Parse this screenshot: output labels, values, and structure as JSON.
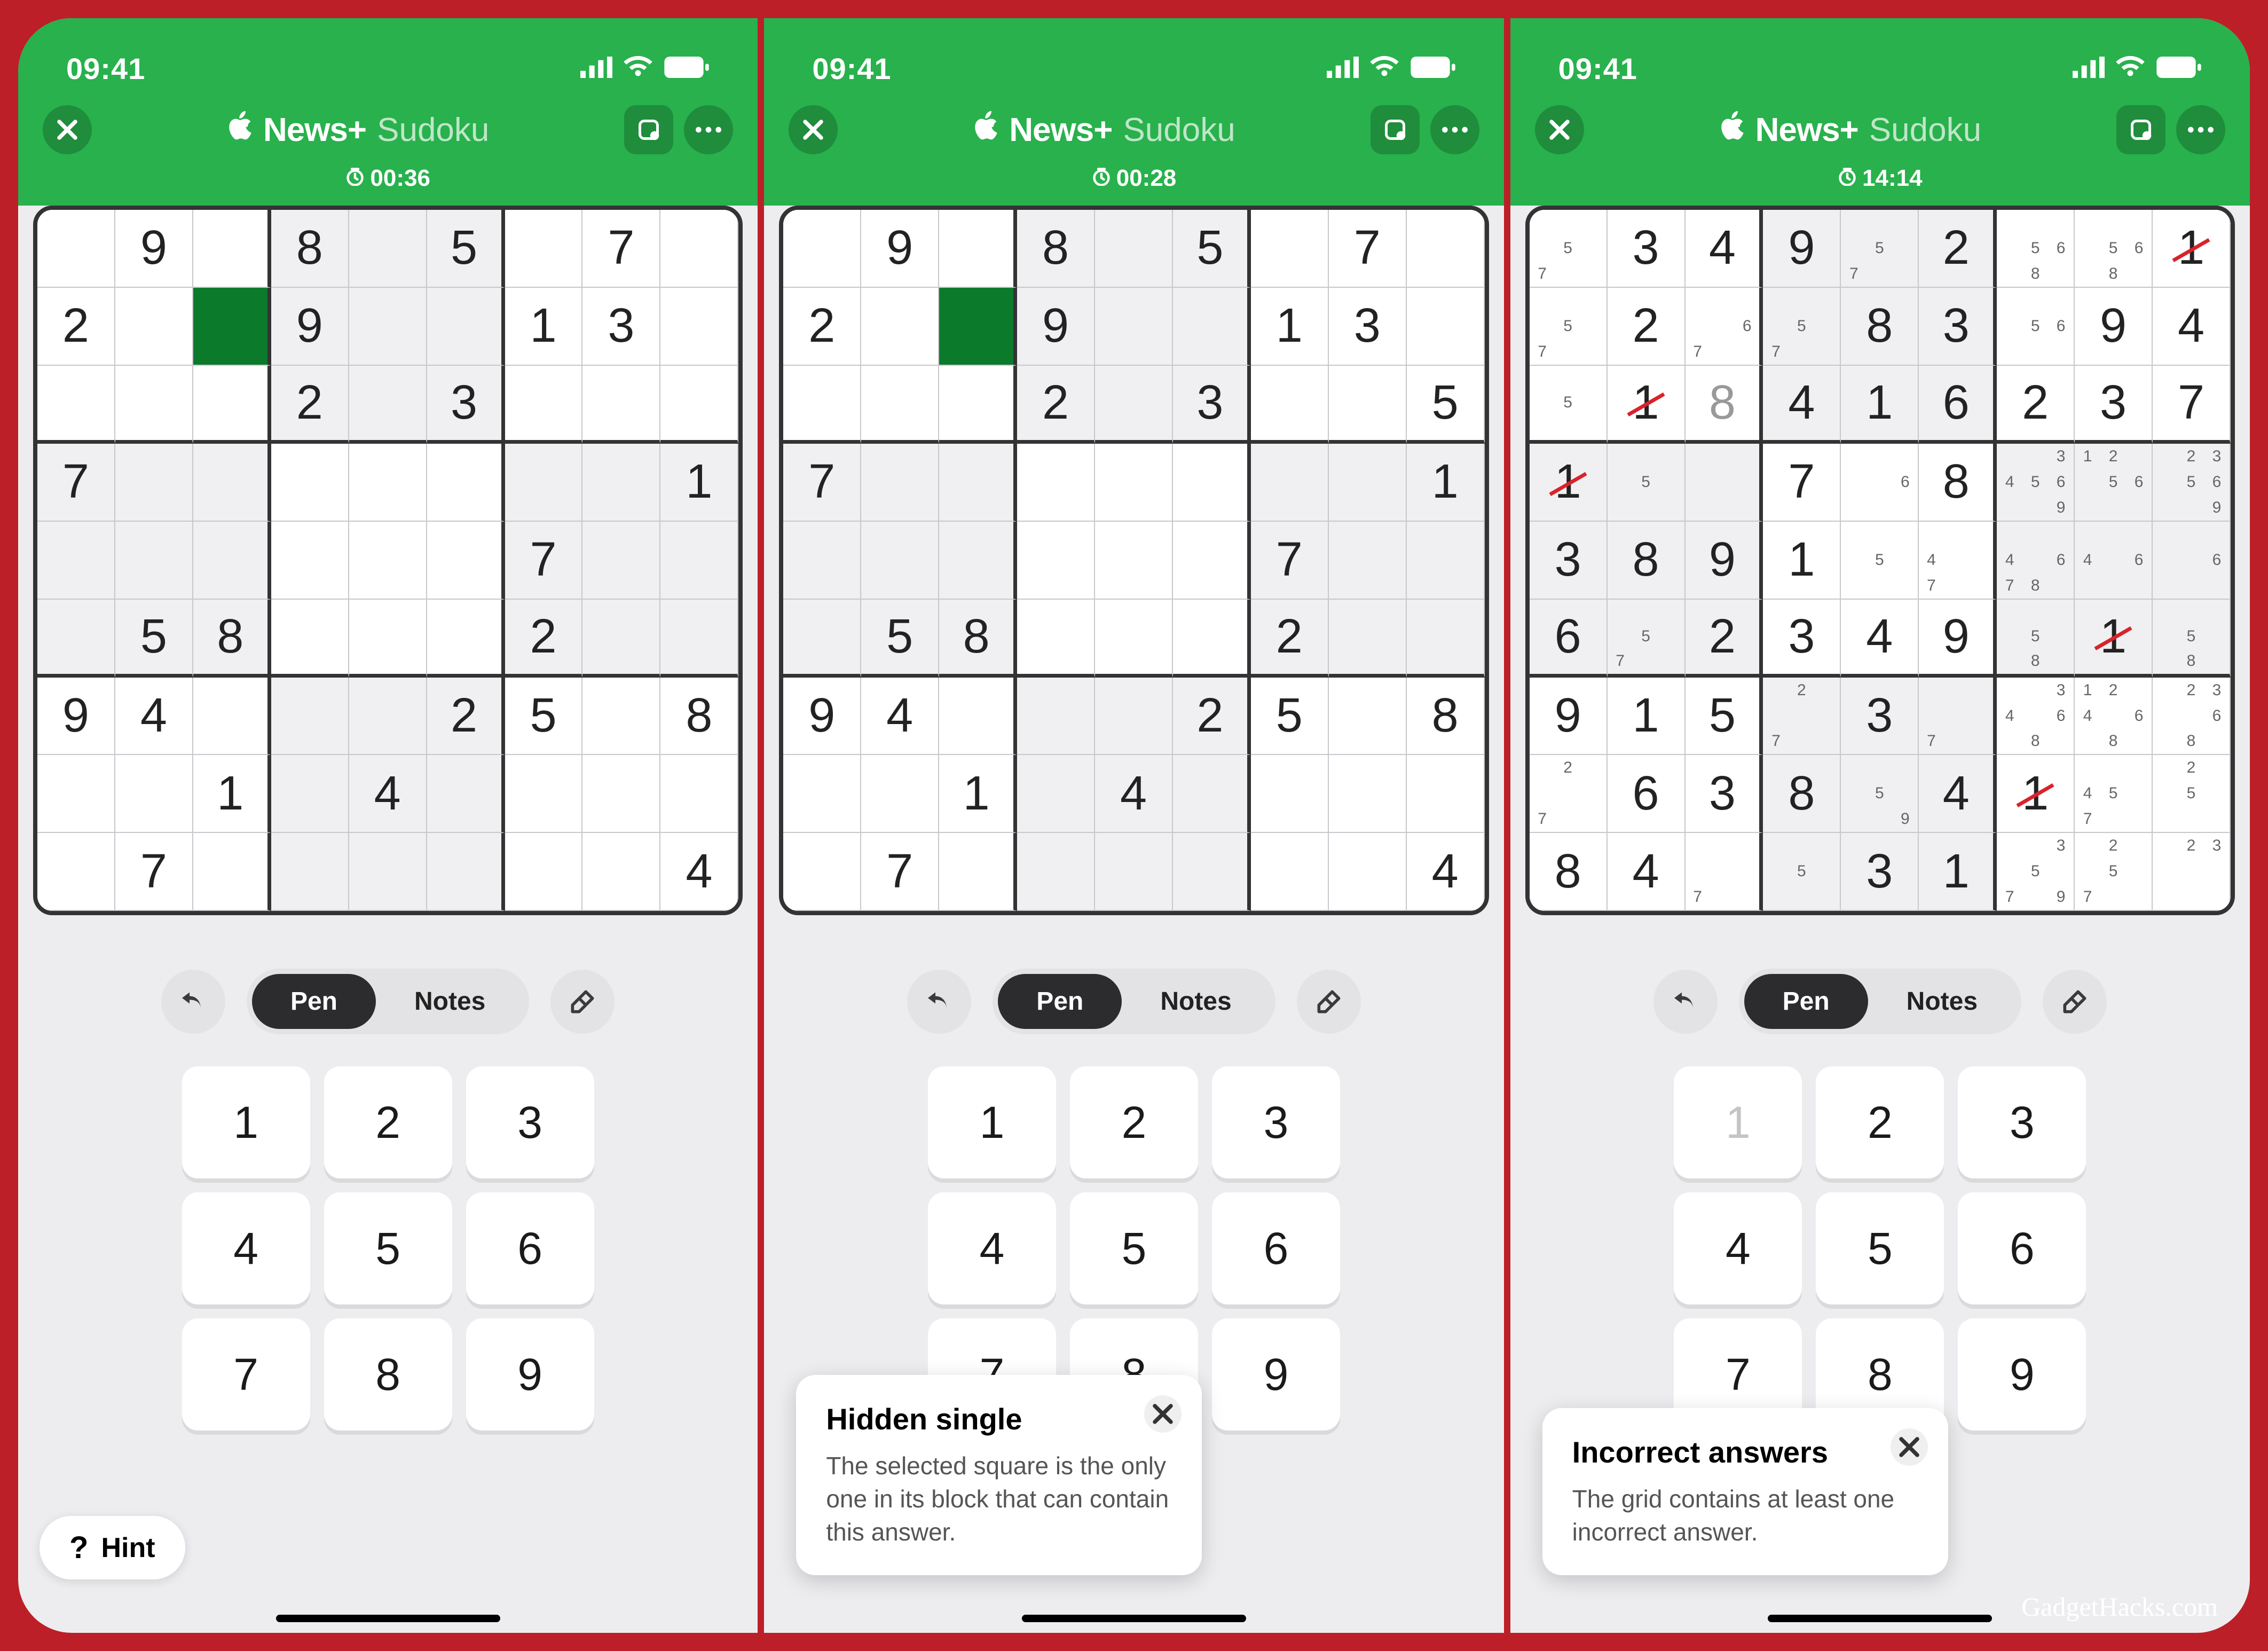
{
  "watermark": "GadgetHacks.com",
  "screens": [
    {
      "status": {
        "time": "09:41"
      },
      "header": {
        "brand": "News+",
        "title": "Sudoku",
        "timer": "00:36"
      },
      "hint_button": {
        "icon": "?",
        "label": "Hint"
      },
      "mode": {
        "pen": "Pen",
        "notes": "Notes"
      },
      "keypad": [
        "1",
        "2",
        "3",
        "4",
        "5",
        "6",
        "7",
        "8",
        "9"
      ],
      "board": [
        [
          "",
          "9",
          "",
          "8",
          "",
          "5",
          "",
          "7",
          ""
        ],
        [
          "2",
          "",
          "",
          "9",
          "",
          "",
          "1",
          "3",
          ""
        ],
        [
          "",
          "",
          "",
          "2",
          "",
          "3",
          "",
          "",
          ""
        ],
        [
          "7",
          "",
          "",
          "",
          "",
          "",
          "",
          "",
          "1"
        ],
        [
          "",
          "",
          "",
          "",
          "",
          "",
          "7",
          "",
          ""
        ],
        [
          "",
          "5",
          "8",
          "",
          "",
          "",
          "2",
          "",
          ""
        ],
        [
          "9",
          "4",
          "",
          "",
          "",
          "2",
          "5",
          "",
          "8"
        ],
        [
          "",
          "",
          "1",
          "",
          "4",
          "",
          "",
          "",
          ""
        ],
        [
          "",
          "7",
          "",
          "",
          "",
          "",
          "",
          "",
          "4"
        ]
      ],
      "selected": [
        1,
        2
      ]
    },
    {
      "status": {
        "time": "09:41"
      },
      "header": {
        "brand": "News+",
        "title": "Sudoku",
        "timer": "00:28"
      },
      "mode": {
        "pen": "Pen",
        "notes": "Notes"
      },
      "tip": {
        "title": "Hidden single",
        "body": "The selected square is the only one in its block that can contain this answer."
      },
      "keypad": [
        "1",
        "2",
        "3",
        "4",
        "5",
        "6",
        "7",
        "8",
        "9"
      ],
      "board": [
        [
          "",
          "9",
          "",
          "8",
          "",
          "5",
          "",
          "7",
          ""
        ],
        [
          "2",
          "",
          "",
          "9",
          "",
          "",
          "1",
          "3",
          ""
        ],
        [
          "",
          "",
          "",
          "2",
          "",
          "3",
          "",
          "",
          "5"
        ],
        [
          "7",
          "",
          "",
          "",
          "",
          "",
          "",
          "",
          "1"
        ],
        [
          "",
          "",
          "",
          "",
          "",
          "",
          "7",
          "",
          ""
        ],
        [
          "",
          "5",
          "8",
          "",
          "",
          "",
          "2",
          "",
          ""
        ],
        [
          "9",
          "4",
          "",
          "",
          "",
          "2",
          "5",
          "",
          "8"
        ],
        [
          "",
          "",
          "1",
          "",
          "4",
          "",
          "",
          "",
          ""
        ],
        [
          "",
          "7",
          "",
          "",
          "",
          "",
          "",
          "",
          "4"
        ]
      ],
      "selected": [
        1,
        2
      ]
    },
    {
      "status": {
        "time": "09:41"
      },
      "header": {
        "brand": "News+",
        "title": "Sudoku",
        "timer": "14:14"
      },
      "mode": {
        "pen": "Pen",
        "notes": "Notes"
      },
      "tip": {
        "title": "Incorrect answers",
        "body": "The grid contains at least one incorrect answer."
      },
      "keypad": [
        "1",
        "2",
        "3",
        "4",
        "5",
        "6",
        "7",
        "8",
        "9"
      ],
      "keypad_dim": [
        0
      ],
      "board": [
        [
          {
            "n": [
              "",
              "",
              "",
              "",
              "5",
              "",
              "7",
              "",
              ""
            ]
          },
          "3",
          "4",
          "9",
          {
            "n": [
              "",
              "",
              "",
              "",
              "5",
              "",
              "7",
              "",
              ""
            ]
          },
          "2",
          {
            "n": [
              "",
              "",
              "",
              "",
              "5",
              "6",
              "",
              "8",
              ""
            ]
          },
          {
            "n": [
              "",
              "",
              "",
              "",
              "5",
              "6",
              "",
              "8",
              ""
            ]
          },
          {
            "v": "1",
            "strike": true
          }
        ],
        [
          {
            "n": [
              "",
              "",
              "",
              "",
              "5",
              "",
              "7",
              "",
              ""
            ]
          },
          "2",
          {
            "n": [
              "",
              "",
              "",
              "",
              "",
              "6",
              "7",
              "",
              ""
            ]
          },
          {
            "n": [
              "",
              "",
              "",
              "",
              "5",
              "",
              "7",
              "",
              ""
            ]
          },
          "8",
          "3",
          {
            "n": [
              "",
              "",
              "",
              "",
              "5",
              "6",
              "",
              "",
              ""
            ]
          },
          "9",
          "4"
        ],
        [
          {
            "n": [
              "",
              "",
              "",
              "",
              "5",
              "",
              "",
              "",
              ""
            ]
          },
          {
            "v": "1",
            "strike": true
          },
          {
            "v": "8",
            "user": true
          },
          "4",
          "1",
          "6",
          "2",
          "3",
          "7"
        ],
        [
          {
            "v": "1",
            "strike": true
          },
          {
            "n": [
              "",
              "",
              "",
              "",
              "5",
              "",
              "",
              "",
              ""
            ]
          },
          "",
          "7",
          {
            "n": [
              "",
              "",
              "",
              "",
              "",
              "6",
              "",
              "",
              ""
            ]
          },
          "8",
          {
            "n": [
              "",
              "",
              "3",
              "4",
              "5",
              "6",
              "",
              "",
              "9"
            ]
          },
          {
            "n": [
              "1",
              "2",
              "",
              "",
              "5",
              "6",
              "",
              "",
              ""
            ]
          },
          {
            "n": [
              "",
              "2",
              "3",
              "",
              "5",
              "6",
              "",
              "",
              "9"
            ]
          }
        ],
        [
          "3",
          "8",
          "9",
          "1",
          {
            "n": [
              "",
              "",
              "",
              "",
              "5",
              "",
              "",
              "",
              ""
            ]
          },
          {
            "n": [
              "",
              "",
              "",
              "4",
              "",
              "",
              "7",
              "",
              ""
            ]
          },
          {
            "n": [
              "",
              "",
              "",
              "4",
              "",
              "6",
              "7",
              "8",
              ""
            ]
          },
          {
            "n": [
              "",
              "",
              "",
              "4",
              "",
              "6",
              "",
              "",
              ""
            ]
          },
          {
            "n": [
              "",
              "",
              "",
              "",
              "",
              "6",
              "",
              "",
              ""
            ]
          }
        ],
        [
          "6",
          {
            "n": [
              "",
              "",
              "",
              "",
              "5",
              "",
              "7",
              "",
              ""
            ]
          },
          "2",
          "3",
          "4",
          "9",
          {
            "n": [
              "",
              "",
              "",
              "",
              "5",
              "",
              "",
              "8",
              ""
            ]
          },
          {
            "v": "1",
            "strike": true
          },
          {
            "n": [
              "",
              "",
              "",
              "",
              "5",
              "",
              "",
              "8",
              ""
            ]
          }
        ],
        [
          "9",
          "1",
          "5",
          {
            "n": [
              "",
              "2",
              "",
              "",
              "",
              "",
              "7",
              "",
              ""
            ]
          },
          "3",
          {
            "n": [
              "",
              "",
              "",
              "",
              "",
              "",
              "7",
              "",
              ""
            ]
          },
          {
            "n": [
              "",
              "",
              "3",
              "4",
              "",
              "6",
              "",
              "8",
              ""
            ]
          },
          {
            "n": [
              "1",
              "2",
              "",
              "4",
              "",
              "6",
              "",
              "8",
              ""
            ]
          },
          {
            "n": [
              "",
              "2",
              "3",
              "",
              "",
              "6",
              "",
              "8",
              ""
            ]
          }
        ],
        [
          {
            "n": [
              "",
              "2",
              "",
              "",
              "",
              "",
              "7",
              "",
              ""
            ]
          },
          "6",
          "3",
          "8",
          {
            "n": [
              "",
              "",
              "",
              "",
              "5",
              "",
              "",
              "",
              "9"
            ]
          },
          "4",
          {
            "v": "1",
            "strike": true
          },
          {
            "n": [
              "",
              "",
              "",
              "4",
              "5",
              "",
              "7",
              "",
              ""
            ]
          },
          {
            "n": [
              "",
              "2",
              "",
              "",
              "5",
              "",
              "",
              "",
              ""
            ]
          }
        ],
        [
          "8",
          "4",
          {
            "n": [
              "",
              "",
              "",
              "",
              "",
              "",
              "7",
              "",
              ""
            ]
          },
          {
            "n": [
              "",
              "",
              "",
              "",
              "5",
              "",
              "",
              "",
              ""
            ]
          },
          "3",
          "1",
          {
            "n": [
              "",
              "",
              "3",
              "",
              "5",
              "",
              "7",
              "",
              "9"
            ]
          },
          {
            "n": [
              "",
              "2",
              "",
              "",
              "5",
              "",
              "7",
              "",
              ""
            ]
          },
          {
            "n": [
              "",
              "2",
              "3",
              "",
              "",
              "",
              "",
              "",
              ""
            ]
          }
        ]
      ]
    }
  ]
}
